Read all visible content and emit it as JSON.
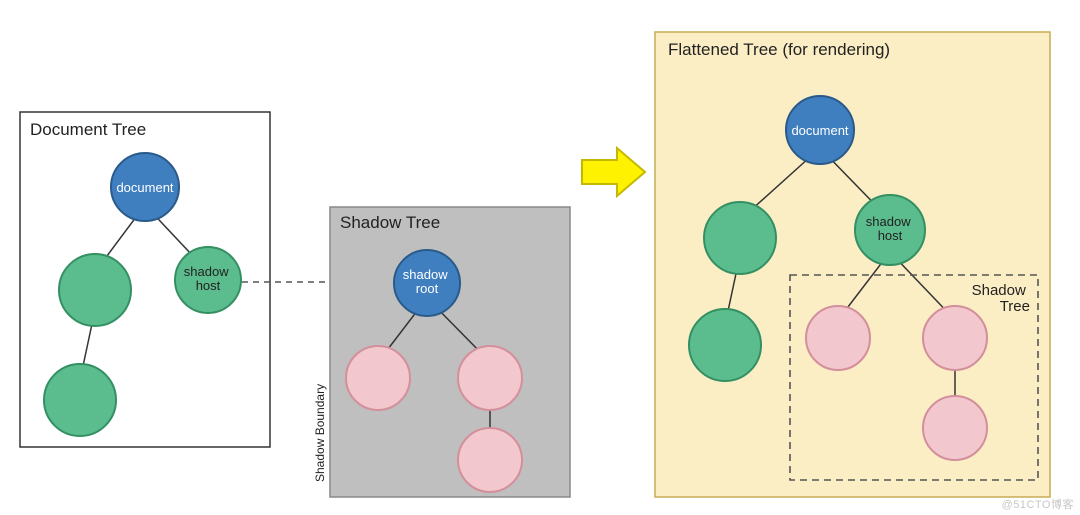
{
  "panels": {
    "document": {
      "title": "Document Tree"
    },
    "shadow": {
      "title": "Shadow Tree",
      "boundary_label": "Shadow Boundary"
    },
    "flattened": {
      "title": "Flattened Tree (for rendering)",
      "inner_label": "Shadow\nTree"
    }
  },
  "nodes": {
    "document_root": "document",
    "shadow_host": "shadow\nhost",
    "shadow_root": "shadow\nroot"
  },
  "colors": {
    "blue": "#3f7fbf",
    "green": "#5bbd8e",
    "pink": "#f2c7ce",
    "shadow_panel": "#bfbfbf",
    "flat_panel": "#fceec4",
    "arrow": "#fff200"
  },
  "watermark": "@51CTO博客"
}
